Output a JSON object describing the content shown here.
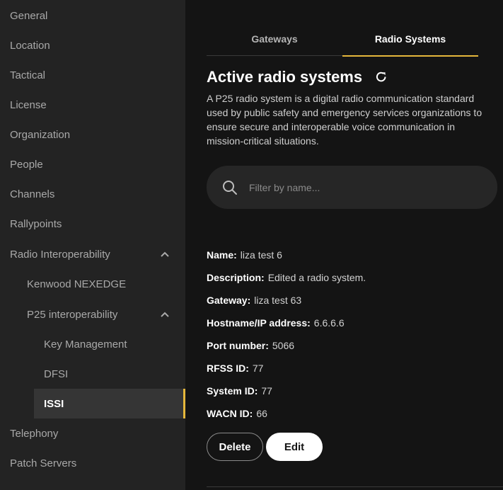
{
  "sidebar": {
    "items": [
      {
        "label": "General"
      },
      {
        "label": "Location"
      },
      {
        "label": "Tactical"
      },
      {
        "label": "License"
      },
      {
        "label": "Organization"
      },
      {
        "label": "People"
      },
      {
        "label": "Channels"
      },
      {
        "label": "Rallypoints"
      },
      {
        "label": "Radio Interoperability",
        "expanded": true
      },
      {
        "label": "Kenwood NEXEDGE"
      },
      {
        "label": "P25 interoperability",
        "expanded": true
      },
      {
        "label": "Key Management"
      },
      {
        "label": "DFSI"
      },
      {
        "label": "ISSI",
        "active": true
      },
      {
        "label": "Telephony"
      },
      {
        "label": "Patch Servers"
      }
    ]
  },
  "tabs": [
    {
      "label": "Gateways"
    },
    {
      "label": "Radio Systems",
      "active": true
    }
  ],
  "main": {
    "title": "Active radio systems",
    "description": "A P25 radio system is a digital radio communication standard used by public safety and emergency services organizations to ensure secure and interoperable voice communication in mission-critical situations.",
    "search_placeholder": "Filter by name..."
  },
  "details": [
    {
      "key": "Name:",
      "value": "liza test 6"
    },
    {
      "key": "Description:",
      "value": "Edited a radio system."
    },
    {
      "key": "Gateway:",
      "value": "liza test 63"
    },
    {
      "key": "Hostname/IP address:",
      "value": "6.6.6.6"
    },
    {
      "key": "Port number:",
      "value": "5066"
    },
    {
      "key": "RFSS ID:",
      "value": "77"
    },
    {
      "key": "System ID:",
      "value": "77"
    },
    {
      "key": "WACN ID:",
      "value": "66"
    }
  ],
  "actions": {
    "delete_label": "Delete",
    "edit_label": "Edit"
  },
  "icons": {
    "refresh": "refresh-icon",
    "search": "search-icon",
    "chevron": "chevron-up-icon"
  },
  "colors": {
    "accent": "#e5b73b",
    "sidebar_bg": "#232323",
    "main_bg": "#141414",
    "active_item_bg": "#353535"
  }
}
